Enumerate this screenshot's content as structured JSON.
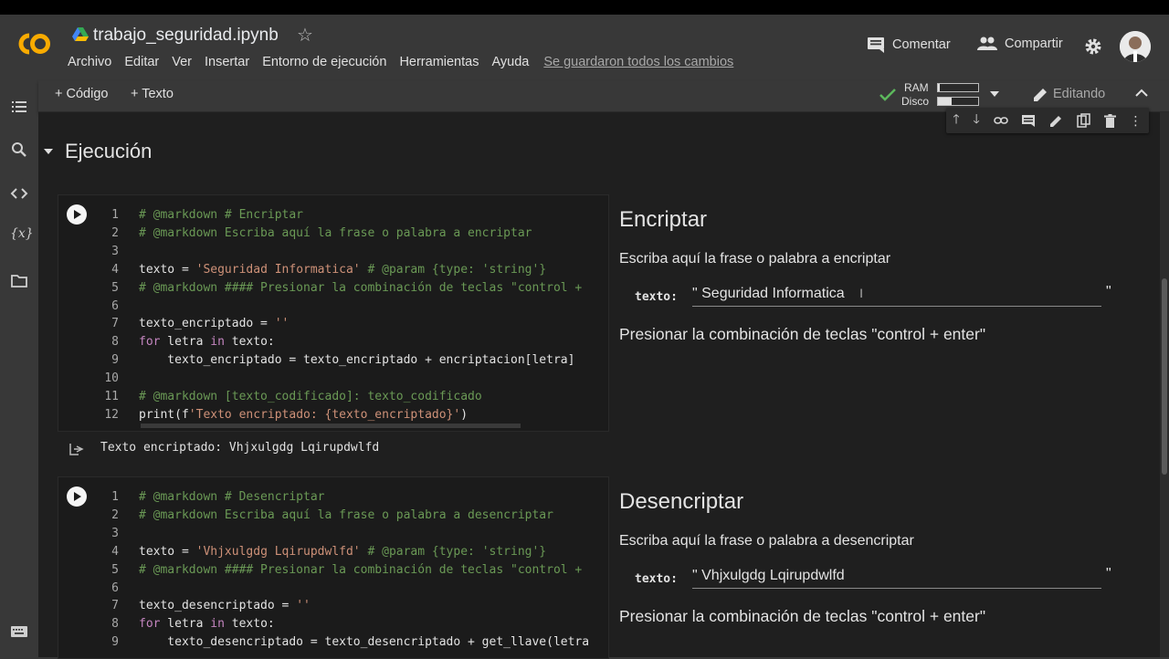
{
  "app": {
    "file_name": "trabajo_seguridad.ipynb",
    "menu": [
      "Archivo",
      "Editar",
      "Ver",
      "Insertar",
      "Entorno de ejecución",
      "Herramientas",
      "Ayuda"
    ],
    "save_status": "Se guardaron todos los cambios",
    "comment_label": "Comentar",
    "share_label": "Compartir"
  },
  "toolbar": {
    "add_code": "+ Código",
    "add_text": "+ Texto",
    "ram_label": "RAM",
    "disk_label": "Disco",
    "ram_fraction": 0.05,
    "disk_fraction": 0.35,
    "editing_label": "Editando"
  },
  "section": {
    "title": "Ejecución"
  },
  "cells": [
    {
      "lines": [
        {
          "n": "1",
          "text": "# @markdown # Encriptar"
        },
        {
          "n": "2",
          "text": "# @markdown Escriba aquí la frase o palabra a encriptar"
        },
        {
          "n": "3",
          "text": ""
        },
        {
          "n": "4",
          "text": "texto = 'Seguridad Informatica' # @param {type: 'string'}"
        },
        {
          "n": "5",
          "text": "# @markdown #### Presionar la combinación de teclas \"control +"
        },
        {
          "n": "6",
          "text": ""
        },
        {
          "n": "7",
          "text": "texto_encriptado = ''"
        },
        {
          "n": "8",
          "text": "for letra in texto:"
        },
        {
          "n": "9",
          "text": "    texto_encriptado = texto_encriptado + encriptacion[letra]"
        },
        {
          "n": "10",
          "text": ""
        },
        {
          "n": "11",
          "text": "# @markdown [texto_codificado]: texto_codificado"
        },
        {
          "n": "12",
          "text": "print(f'Texto encriptado: {texto_encriptado}')"
        }
      ],
      "form": {
        "title": "Encriptar",
        "description": "Escriba aquí la frase o palabra a encriptar",
        "field_label": "texto:",
        "field_value": "\" Seguridad Informatica",
        "field_end": "\"",
        "instruction": "Presionar la combinación de teclas \"control + enter\""
      },
      "output": "Texto encriptado: Vhjxulgdg Lqirupdwlfd"
    },
    {
      "lines": [
        {
          "n": "1",
          "text": "# @markdown # Desencriptar"
        },
        {
          "n": "2",
          "text": "# @markdown Escriba aquí la frase o palabra a desencriptar"
        },
        {
          "n": "3",
          "text": ""
        },
        {
          "n": "4",
          "text": "texto = 'Vhjxulgdg Lqirupdwlfd' # @param {type: 'string'}"
        },
        {
          "n": "5",
          "text": "# @markdown #### Presionar la combinación de teclas \"control +"
        },
        {
          "n": "6",
          "text": ""
        },
        {
          "n": "7",
          "text": "texto_desencriptado = ''"
        },
        {
          "n": "8",
          "text": "for letra in texto:"
        },
        {
          "n": "9",
          "text": "    texto_desencriptado = texto_desencriptado + get_llave(letra"
        }
      ],
      "form": {
        "title": "Desencriptar",
        "description": "Escriba aquí la frase o palabra a desencriptar",
        "field_label": "texto:",
        "field_value": "\" Vhjxulgdg Lqirupdwlfd",
        "field_end": "\"",
        "instruction": "Presionar la combinación de teclas \"control + enter\""
      }
    }
  ]
}
